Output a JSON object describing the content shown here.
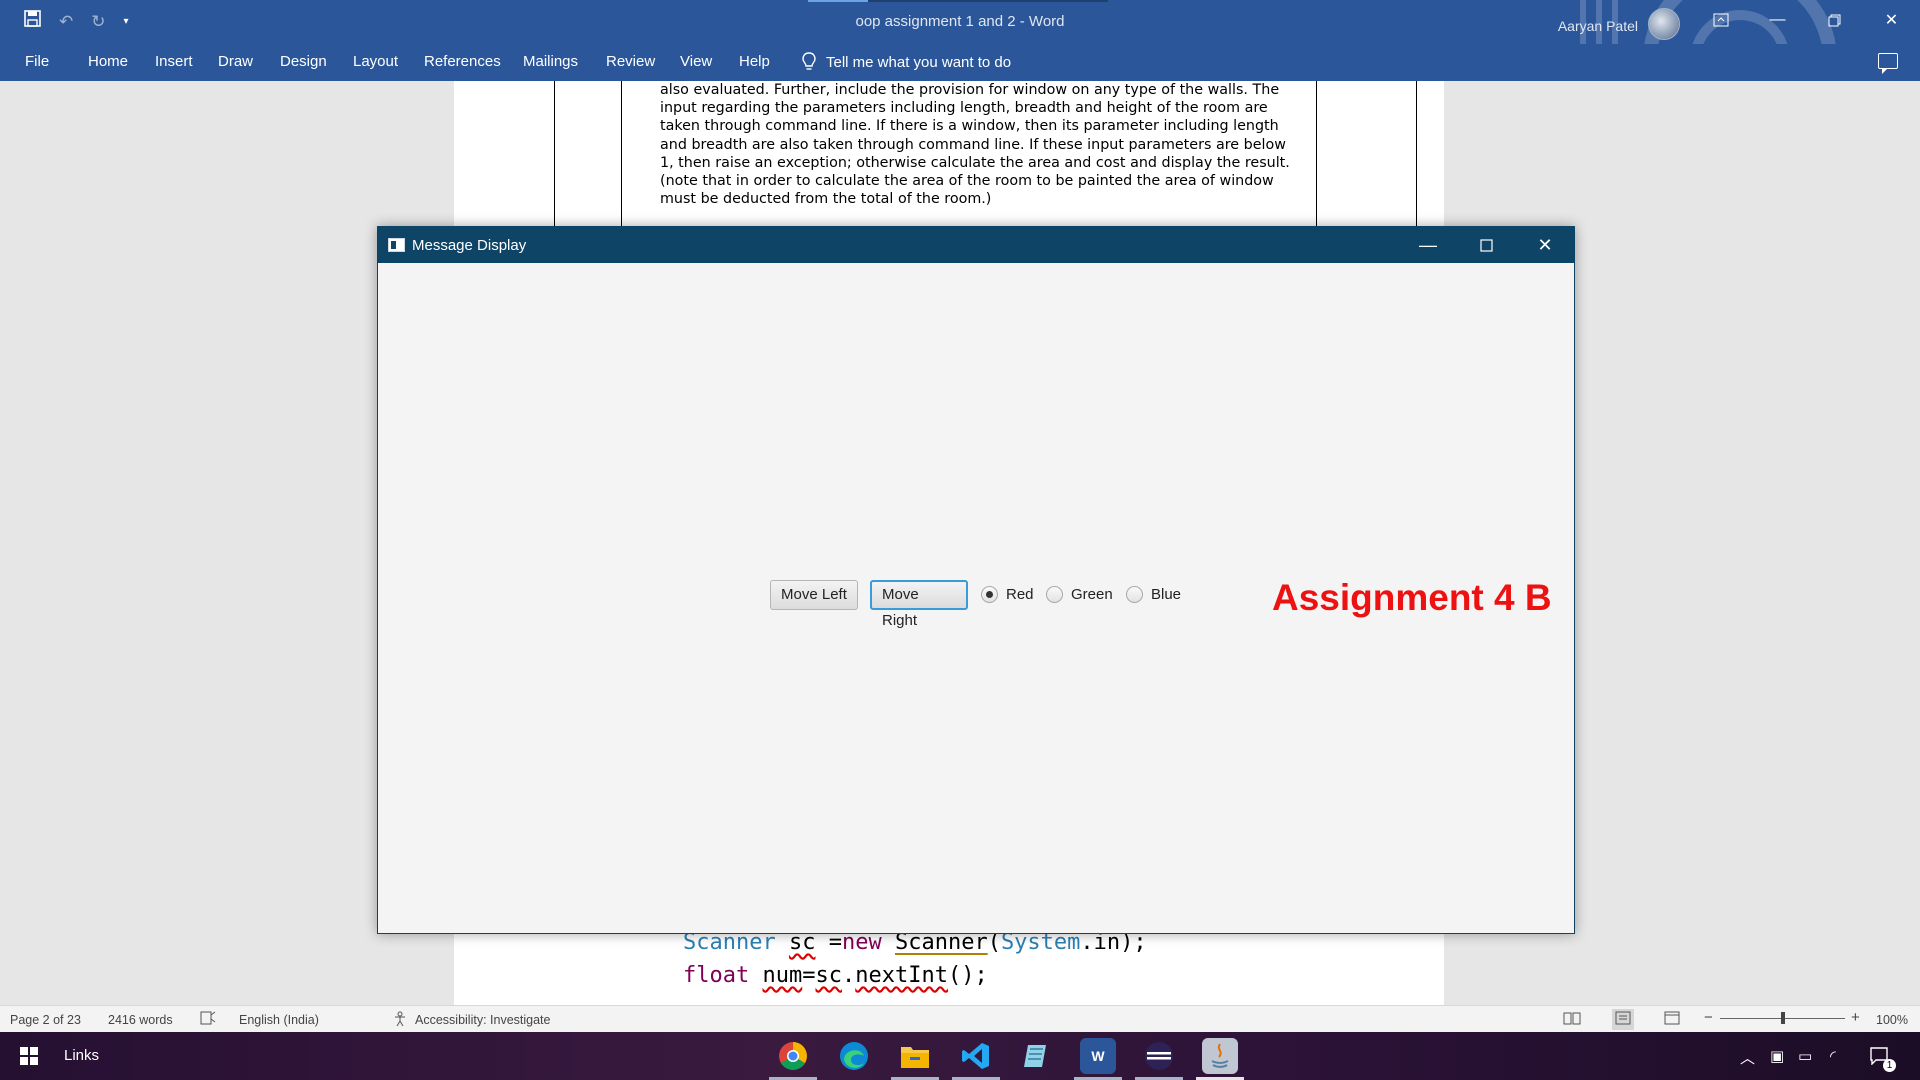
{
  "word": {
    "title": "oop assignment 1 and 2  -  Word",
    "user_name": "Aaryan Patel",
    "qat": {
      "save_icon": "save-icon",
      "undo_icon": "undo-icon",
      "redo_icon": "redo-icon",
      "customize_icon": "customize-qat-icon"
    },
    "menu": [
      "File",
      "Home",
      "Insert",
      "Draw",
      "Design",
      "Layout",
      "References",
      "Mailings",
      "Review",
      "View",
      "Help"
    ],
    "tell_me": "Tell me what you want to do"
  },
  "document": {
    "paragraph_lines": [
      "also evaluated. Further, include the provision for window on any type of the walls. The",
      "input regarding the parameters including length, breadth and height of the room are",
      "taken through command line. If there is a window, then its parameter including length",
      "and breadth are also taken through command line. If these input parameters are below",
      "1, then raise an exception; otherwise calculate the area and cost and display the result.",
      "(note that in order to calculate the area of the room to be painted the area of window",
      "must be deducted from the total of the room.)"
    ],
    "code_line_1": {
      "t1": "Scanner",
      "sp1": " ",
      "v1": "sc",
      "op": " =",
      "kw": "new",
      "sp2": " ",
      "t2": "Scanner",
      "p1": "(",
      "t3": "System",
      "rest": ".in);"
    },
    "code_line_2": {
      "kw": "float",
      "sp": " ",
      "v": "num",
      "eq": "=",
      "v2": "sc",
      "dot": ".",
      "m": "nextInt",
      "rest": "();"
    }
  },
  "app_window": {
    "title": "Message Display",
    "controls": {
      "minimize": "minimize-icon",
      "maximize": "maximize-icon",
      "close": "close-icon"
    },
    "move_left_label": "Move Left",
    "move_right_label": "Move Right",
    "radios": [
      {
        "label": "Red",
        "selected": true
      },
      {
        "label": "Green",
        "selected": false
      },
      {
        "label": "Blue",
        "selected": false
      }
    ],
    "message": "Assignment 4 B",
    "message_color": "#ee1111"
  },
  "status_bar": {
    "page": "Page 2 of 23",
    "words": "2416 words",
    "language": "English (India)",
    "accessibility": "Accessibility: Investigate",
    "zoom": "100%",
    "zoom_minus": "−",
    "zoom_plus": "+"
  },
  "taskbar": {
    "links_label": "Links",
    "apps": [
      "chrome-icon",
      "edge-icon",
      "file-explorer-icon",
      "vscode-icon",
      "notepad-icon",
      "word-icon",
      "eclipse-icon",
      "java-icon"
    ],
    "notification_count": "1"
  },
  "colors": {
    "word_blue": "#2b579a",
    "app_title_bar": "#0e4466",
    "focus_border": "#3a9bd8"
  }
}
